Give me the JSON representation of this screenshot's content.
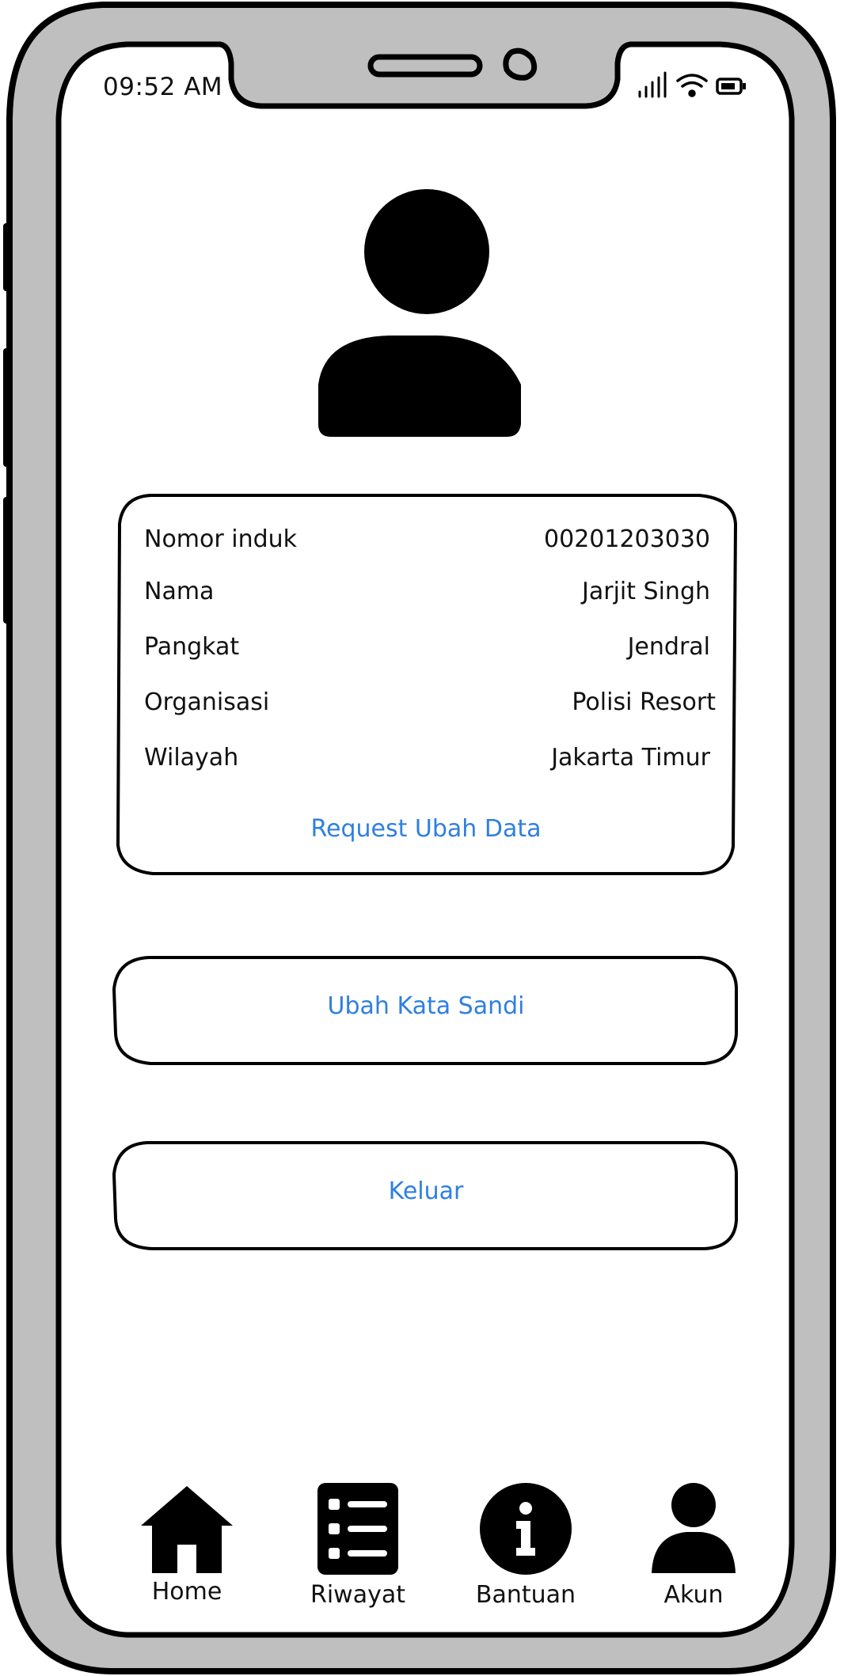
{
  "status_bar": {
    "time": "09:52 AM"
  },
  "profile": {
    "fields": [
      {
        "label": "Nomor induk",
        "value": "00201203030"
      },
      {
        "label": "Nama",
        "value": "Jarjit Singh"
      },
      {
        "label": "Pangkat",
        "value": "Jendral"
      },
      {
        "label": "Organisasi",
        "value": "Polisi Resort"
      },
      {
        "label": "Wilayah",
        "value": "Jakarta Timur"
      }
    ],
    "request_change_label": "Request Ubah Data"
  },
  "actions": {
    "change_password_label": "Ubah Kata Sandi",
    "logout_label": "Keluar"
  },
  "bottom_nav": {
    "items": [
      {
        "label": "Home",
        "icon": "home-icon"
      },
      {
        "label": "Riwayat",
        "icon": "list-icon"
      },
      {
        "label": "Bantuan",
        "icon": "info-icon"
      },
      {
        "label": "Akun",
        "icon": "user-icon"
      }
    ]
  },
  "colors": {
    "link": "#2f7fe0",
    "frame": "#bfbfbf",
    "ink": "#000000"
  }
}
